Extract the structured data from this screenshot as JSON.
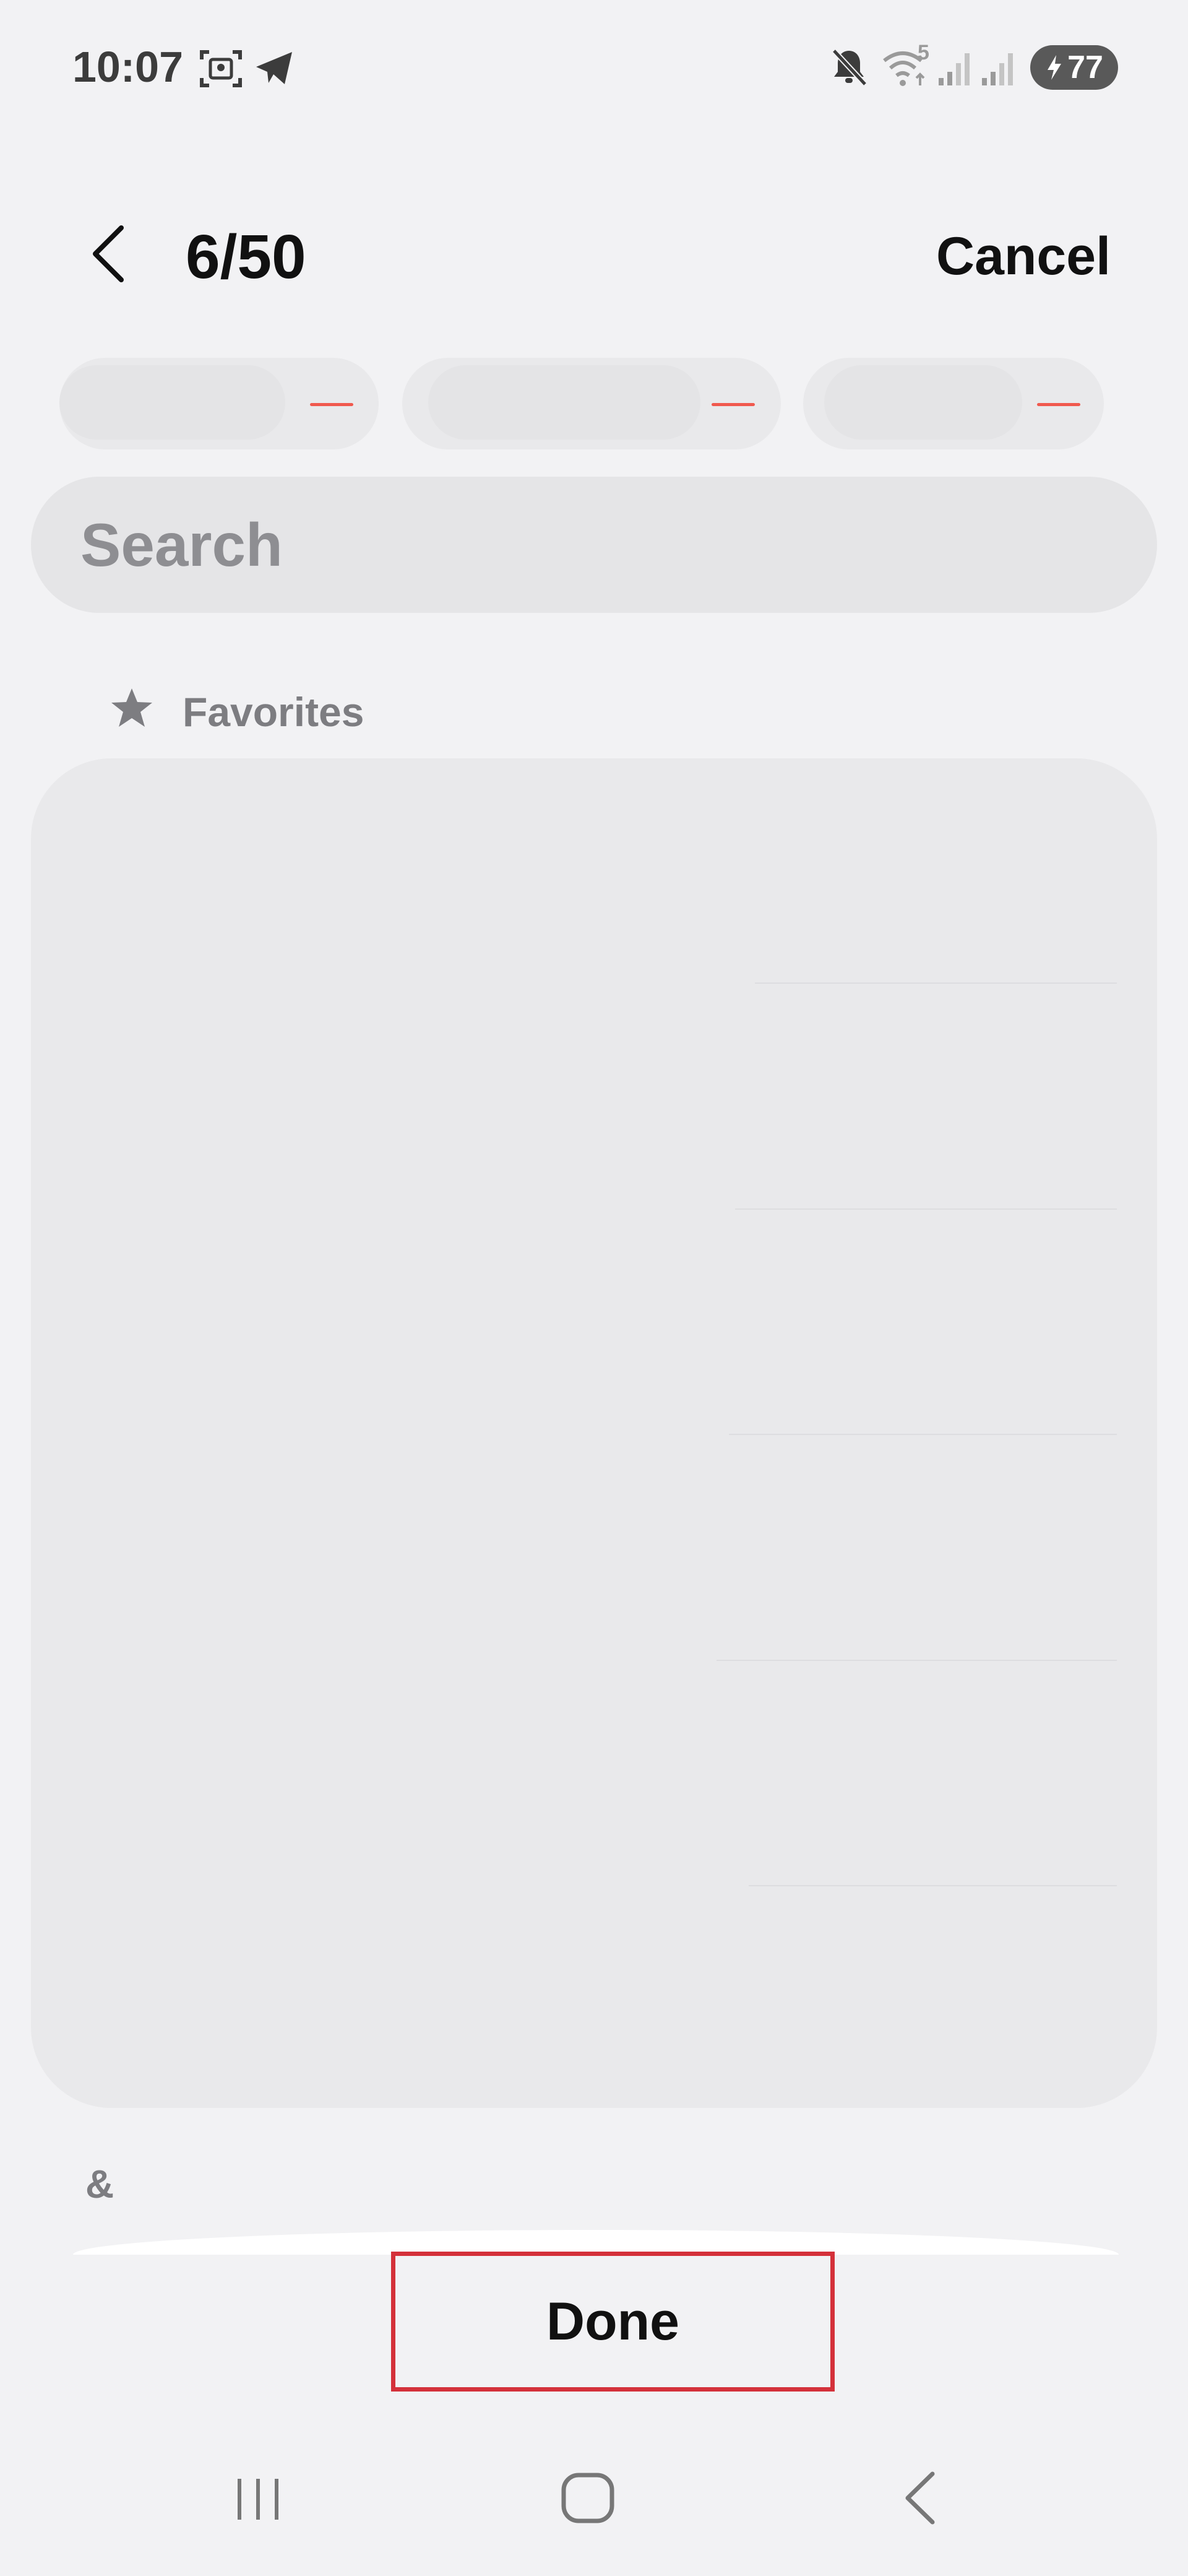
{
  "status_bar": {
    "time": "10:07",
    "wifi_badge": "5",
    "battery_level": "77",
    "icons": [
      "screenshot-icon",
      "telegram-icon",
      "mute-icon",
      "wifi-icon",
      "signal-icon",
      "signal-icon",
      "battery-charging-icon"
    ]
  },
  "header": {
    "counter": "6/50",
    "cancel_label": "Cancel",
    "back_icon": "chevron-left-icon"
  },
  "chips": {
    "count": 3,
    "remove_icon": "minus-icon",
    "remove_color": "#f0594e"
  },
  "search": {
    "placeholder": "Search"
  },
  "favorites": {
    "label": "Favorites",
    "icon": "star-icon"
  },
  "section": {
    "label": "&"
  },
  "actions": {
    "done_label": "Done"
  },
  "navigation_bar": {
    "icons": [
      "recent-apps-icon",
      "home-icon",
      "back-icon"
    ]
  },
  "colors": {
    "background": "#f2f2f4",
    "highlight_border": "#d4313a",
    "muted_text": "#8e8e92"
  }
}
